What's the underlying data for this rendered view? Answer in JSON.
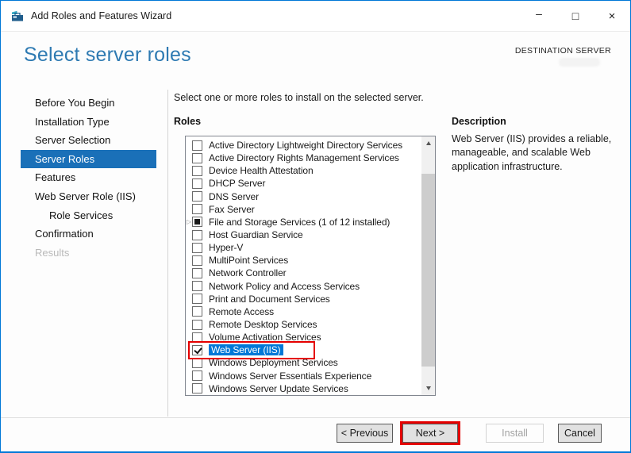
{
  "window": {
    "title": "Add Roles and Features Wizard",
    "controls": {
      "minimize": "–",
      "maximize": "□",
      "close": "×"
    }
  },
  "header": {
    "title": "Select server roles",
    "destination": "DESTINATION SERVER"
  },
  "sidebar": {
    "items": [
      {
        "label": "Before You Begin",
        "state": "normal"
      },
      {
        "label": "Installation Type",
        "state": "normal"
      },
      {
        "label": "Server Selection",
        "state": "normal"
      },
      {
        "label": "Server Roles",
        "state": "selected"
      },
      {
        "label": "Features",
        "state": "normal"
      },
      {
        "label": "Web Server Role (IIS)",
        "state": "normal"
      },
      {
        "label": "Role Services",
        "state": "normal",
        "indent": true
      },
      {
        "label": "Confirmation",
        "state": "normal"
      },
      {
        "label": "Results",
        "state": "disabled"
      }
    ]
  },
  "main": {
    "instruction": "Select one or more roles to install on the selected server.",
    "roles_header": "Roles",
    "roles": [
      {
        "label": "Active Directory Lightweight Directory Services",
        "checkbox": "unchecked"
      },
      {
        "label": "Active Directory Rights Management Services",
        "checkbox": "unchecked"
      },
      {
        "label": "Device Health Attestation",
        "checkbox": "unchecked"
      },
      {
        "label": "DHCP Server",
        "checkbox": "unchecked"
      },
      {
        "label": "DNS Server",
        "checkbox": "unchecked"
      },
      {
        "label": "Fax Server",
        "checkbox": "unchecked"
      },
      {
        "label": "File and Storage Services (1 of 12 installed)",
        "checkbox": "partial",
        "expandable": true
      },
      {
        "label": "Host Guardian Service",
        "checkbox": "unchecked"
      },
      {
        "label": "Hyper-V",
        "checkbox": "unchecked"
      },
      {
        "label": "MultiPoint Services",
        "checkbox": "unchecked"
      },
      {
        "label": "Network Controller",
        "checkbox": "unchecked"
      },
      {
        "label": "Network Policy and Access Services",
        "checkbox": "unchecked"
      },
      {
        "label": "Print and Document Services",
        "checkbox": "unchecked"
      },
      {
        "label": "Remote Access",
        "checkbox": "unchecked"
      },
      {
        "label": "Remote Desktop Services",
        "checkbox": "unchecked"
      },
      {
        "label": "Volume Activation Services",
        "checkbox": "unchecked"
      },
      {
        "label": "Web Server (IIS)",
        "checkbox": "checked",
        "selected": true,
        "annotated": true
      },
      {
        "label": "Windows Deployment Services",
        "checkbox": "unchecked"
      },
      {
        "label": "Windows Server Essentials Experience",
        "checkbox": "unchecked"
      },
      {
        "label": "Windows Server Update Services",
        "checkbox": "unchecked"
      }
    ],
    "description": {
      "header": "Description",
      "text": "Web Server (IIS) provides a reliable, manageable, and scalable Web application infrastructure."
    }
  },
  "footer": {
    "previous_label": "< Previous",
    "next_label": "Next >",
    "install_label": "Install",
    "cancel_label": "Cancel"
  },
  "icons": {
    "app": "toolbox-icon",
    "expander_collapsed": "▷",
    "scroll_up": "triangle-up",
    "scroll_down": "triangle-down"
  },
  "colors": {
    "window_border": "#0078d7",
    "header_title": "#2e7ab2",
    "sidebar_selected": "#1a70b8",
    "list_selection": "#0078d7",
    "annotation_red": "#e50000"
  }
}
